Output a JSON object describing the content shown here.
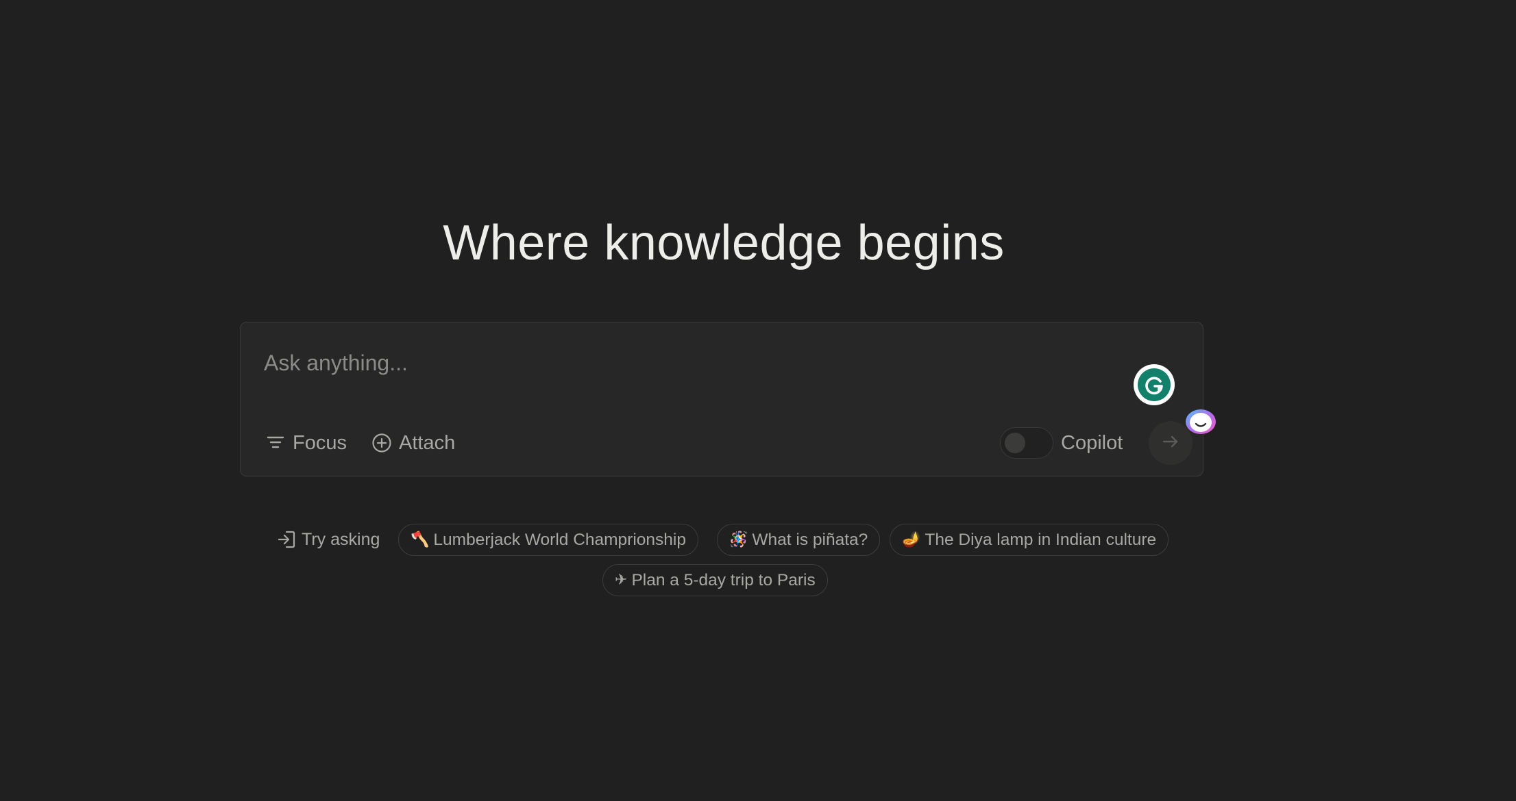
{
  "hero": {
    "title": "Where knowledge begins"
  },
  "search": {
    "placeholder": "Ask anything...",
    "value": ""
  },
  "toolbar": {
    "focus_label": "Focus",
    "attach_label": "Attach",
    "copilot_label": "Copilot",
    "copilot_enabled": false
  },
  "suggestions": {
    "label": "Try asking",
    "items": [
      {
        "emoji": "🪓",
        "text": "Lumberjack World Champrionship"
      },
      {
        "emoji": "🪅",
        "text": "What is piñata?"
      },
      {
        "emoji": "🪔",
        "text": "The Diya lamp in Indian culture"
      },
      {
        "emoji": "✈",
        "text": "Plan a 5-day trip to Paris"
      }
    ]
  },
  "icons": {
    "focus": "filter-lines-icon",
    "attach": "plus-circle-icon",
    "submit": "arrow-right-icon",
    "try_asking": "arrow-into-icon",
    "grammarly": "grammarly-g-icon",
    "assistant": "assistant-face-icon"
  },
  "colors": {
    "background": "#202020",
    "panel": "#272727",
    "grammarly": "#12806b",
    "text_primary": "#ededea",
    "text_muted": "#a8a8a4"
  }
}
